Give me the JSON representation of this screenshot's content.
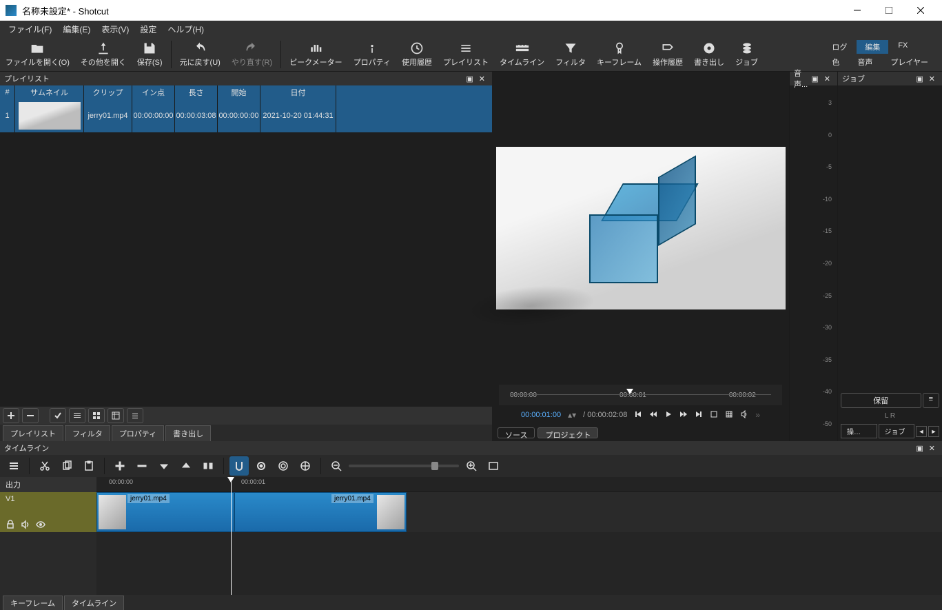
{
  "window": {
    "title": "名称未設定* - Shotcut"
  },
  "menubar": [
    "ファイル(F)",
    "編集(E)",
    "表示(V)",
    "設定",
    "ヘルプ(H)"
  ],
  "toolbar": {
    "open": "ファイルを開く(O)",
    "openOther": "その他を開く",
    "save": "保存(S)",
    "undo": "元に戻す(U)",
    "redo": "やり直す(R)",
    "peakmeter": "ピークメーター",
    "property": "プロパティ",
    "history": "使用履歴",
    "playlist": "プレイリスト",
    "timeline": "タイムライン",
    "filter": "フィルタ",
    "keyframe": "キーフレーム",
    "ops": "操作履歴",
    "export": "書き出し",
    "jobs": "ジョブ"
  },
  "rightTabs": {
    "log": "ログ",
    "edit": "編集",
    "fx": "FX",
    "color": "色",
    "audio": "音声",
    "player": "プレイヤー"
  },
  "playlist": {
    "title": "プレイリスト",
    "cols": {
      "num": "#",
      "thumb": "サムネイル",
      "clip": "クリップ",
      "in": "イン点",
      "len": "長さ",
      "start": "開始",
      "date": "日付"
    },
    "row": {
      "num": "1",
      "clip": "jerry01.mp4",
      "in": "00:00:00:00",
      "len": "00:00:03:08",
      "start": "00:00:00:00",
      "date": "2021-10-20 01:44:31"
    },
    "tabs": [
      "プレイリスト",
      "フィルタ",
      "プロパティ",
      "書き出し"
    ]
  },
  "preview": {
    "scrub": [
      "00:00:00",
      "00:00:01",
      "00:00:02"
    ],
    "time": "00:00:01:00",
    "dur": "/ 00:00:02:08",
    "tabs": {
      "source": "ソース",
      "project": "プロジェクト"
    }
  },
  "meter": {
    "title": "音声...",
    "ticks": [
      "3",
      "0",
      "-5",
      "-10",
      "-15",
      "-20",
      "-25",
      "-30",
      "-35",
      "-40",
      "-50"
    ]
  },
  "jobs": {
    "title": "ジョブ",
    "hold": "保留",
    "lr": "L  R",
    "opsTab": "操…",
    "jobTab": "ジョブ"
  },
  "timeline": {
    "title": "タイムライン",
    "output": "出力",
    "track": "V1",
    "ruler": [
      "00:00:00",
      "00:00:01"
    ],
    "clip1": "jerry01.mp4",
    "clip2": "jerry01.mp4"
  },
  "bottomTabs": [
    "キーフレーム",
    "タイムライン"
  ]
}
